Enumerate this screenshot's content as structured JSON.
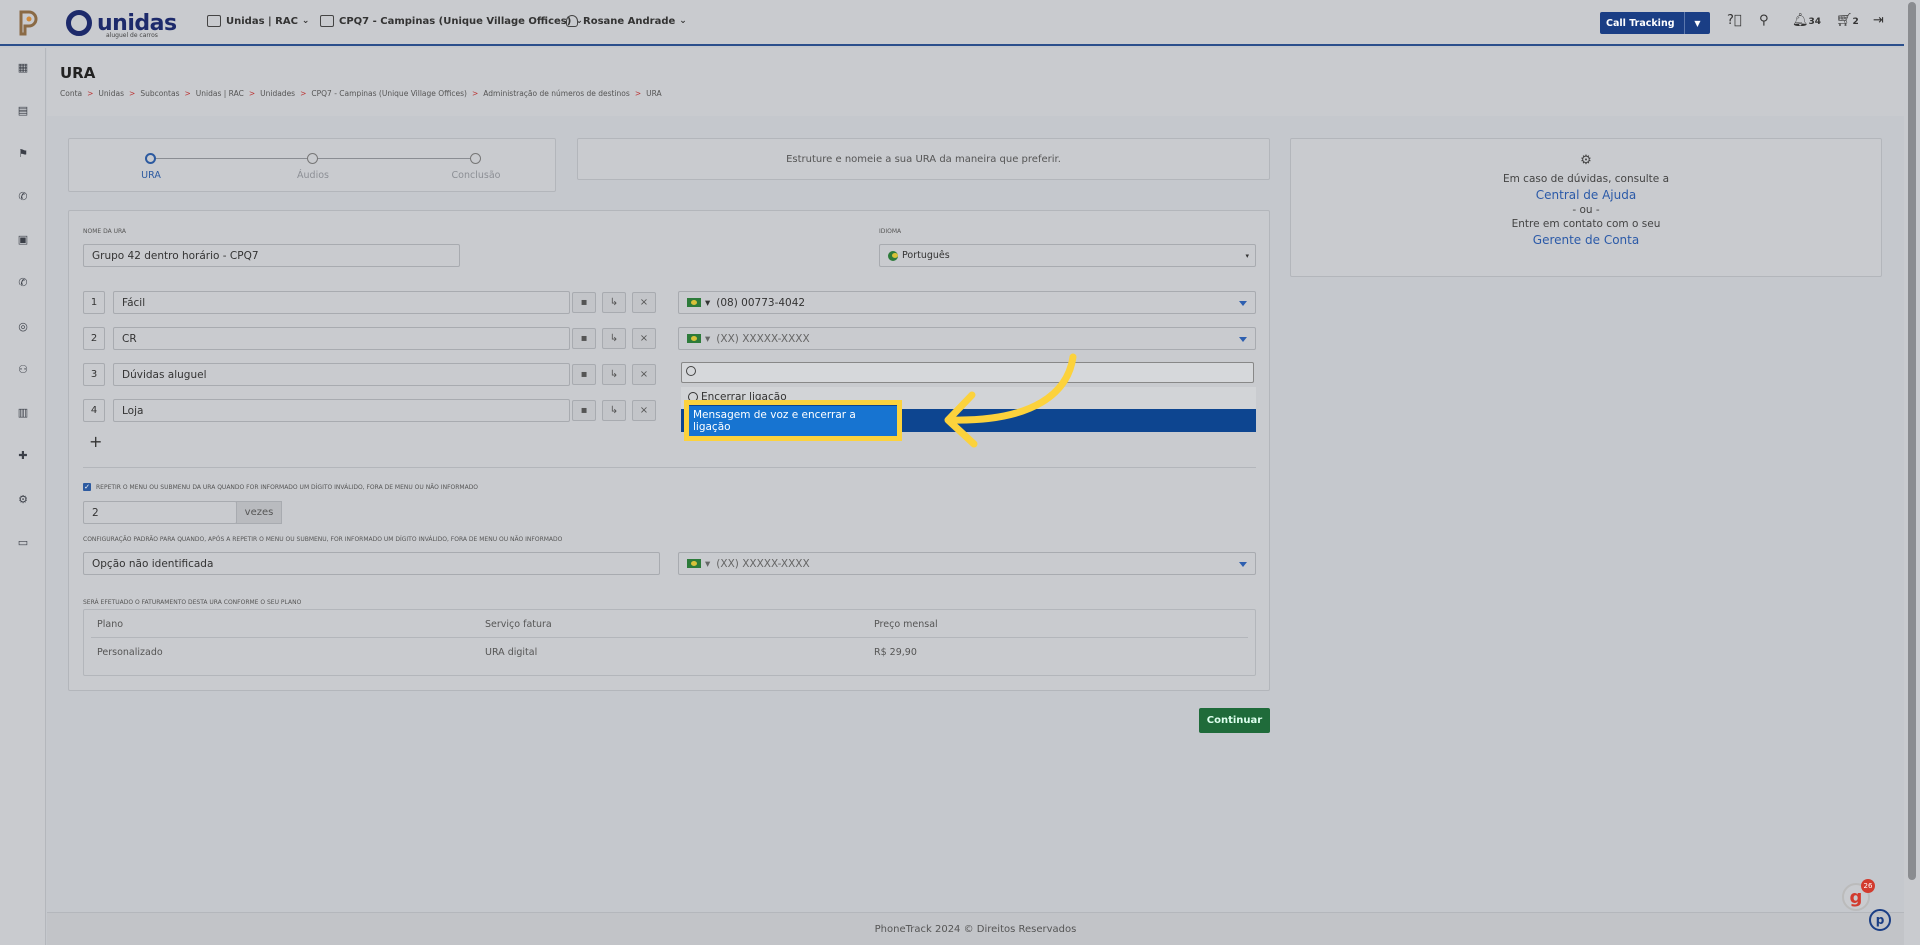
{
  "topbar": {
    "brand_name": "unidas",
    "brand_tagline": "aluguel de carros",
    "account_select": "Unidas | RAC",
    "unit_select": "CPQ7 - Campinas (Unique Village Offices)",
    "user_select": "Rosane Andrade",
    "product_button": "Call Tracking",
    "notifications_count": "34",
    "cart_count": "2"
  },
  "page": {
    "title": "URA",
    "breadcrumbs": [
      "Conta",
      "Unidas",
      "Subcontas",
      "Unidas | RAC",
      "Unidades",
      "CPQ7 - Campinas (Unique Village Offices)",
      "Administração de números de destinos",
      "URA"
    ]
  },
  "stepper": {
    "steps": [
      "URA",
      "Áudios",
      "Conclusão"
    ],
    "active": "URA"
  },
  "intro_text": "Estruture e nomeie a sua URA da maneira que preferir.",
  "help": {
    "line1": "Em caso de dúvidas, consulte a",
    "link1": "Central de Ajuda",
    "or": "- ou -",
    "line2": "Entre em contato com o seu",
    "link2": "Gerente de Conta"
  },
  "form": {
    "name_label": "Nome da URA",
    "name_value": "Grupo 42 dentro horário - CPQ7",
    "language_label": "Idioma",
    "language_value": "Português",
    "options": [
      {
        "num": "1",
        "label": "Fácil",
        "dest": "(08) 00773-4042"
      },
      {
        "num": "2",
        "label": "CR",
        "dest": "(XX) XXXXX-XXXX"
      },
      {
        "num": "3",
        "label": "Dúvidas aluguel",
        "dest": ""
      },
      {
        "num": "4",
        "label": "Loja",
        "dest": ""
      }
    ],
    "repeat_label": "Repetir o menu ou submenu da URA quando for informado um dígito inválido, fora de menu ou não informado",
    "repeat_value": "2",
    "repeat_suffix": "vezes",
    "default_label": "Configuração padrão para quando, após a repetir o menu ou submenu, for informado um dígito inválido, fora de menu ou não informado",
    "default_value": "Opção não identificada",
    "default_dest": "(XX) XXXXX-XXXX",
    "billing_label": "Será efetuado o faturamento desta URA conforme o seu plano",
    "billing_headers": [
      "Plano",
      "Serviço fatura",
      "Preço mensal"
    ],
    "billing_row": [
      "Personalizado",
      "URA digital",
      "R$ 29,90"
    ]
  },
  "dropdown": {
    "option_end_call": "Encerrar ligação",
    "option_voice_end": "Mensagem de voz e encerrar a ligação"
  },
  "continue_button": "Continuar",
  "footer_text": "PhoneTrack 2024 © Direitos Reservados",
  "widget_badge": "26",
  "colors": {
    "accent": "#1a3e85",
    "highlight": "#fcd23c",
    "selected": "#0d4590",
    "success": "#1f6b3a"
  }
}
